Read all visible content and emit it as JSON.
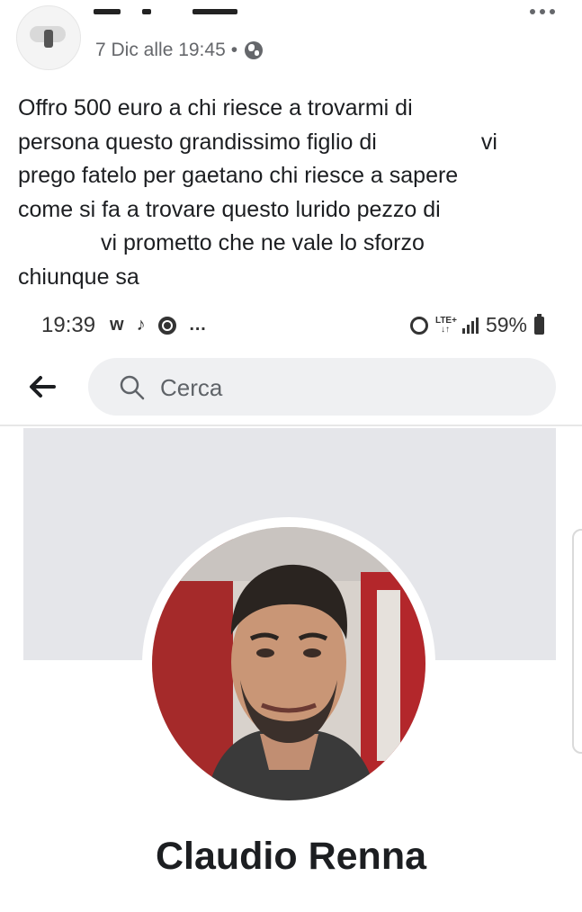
{
  "post": {
    "date": "7 Dic alle 19:45",
    "separator": "•",
    "visibility_icon": "globe-icon",
    "more_icon": "more-horizontal-icon",
    "text_lines": [
      [
        "Offro 500 euro a chi riesce a trovarmi di"
      ],
      [
        "persona questo grandissimo figlio di",
        "vi"
      ],
      [
        "prego fatelo per gaetano chi riesce a sapere"
      ],
      [
        "come si fa a trovare questo lurido pezzo di"
      ],
      [
        "vi prometto che ne vale lo sforzo"
      ],
      [
        "chiunque sa"
      ]
    ]
  },
  "screenshot": {
    "status_bar": {
      "time": "19:39",
      "app_icons": [
        "w",
        "tiktok-icon",
        "chrome-icon",
        "…"
      ],
      "lte_label_top": "LTE+",
      "lte_label_bottom": "↓↑",
      "battery": "59%"
    },
    "search": {
      "placeholder": "Cerca"
    },
    "profile": {
      "name": "Claudio Renna"
    }
  },
  "colors": {
    "text": "#1c1e21",
    "meta": "#65676b",
    "search_bg": "#eff0f2",
    "cover_bg": "#e5e6ea"
  }
}
